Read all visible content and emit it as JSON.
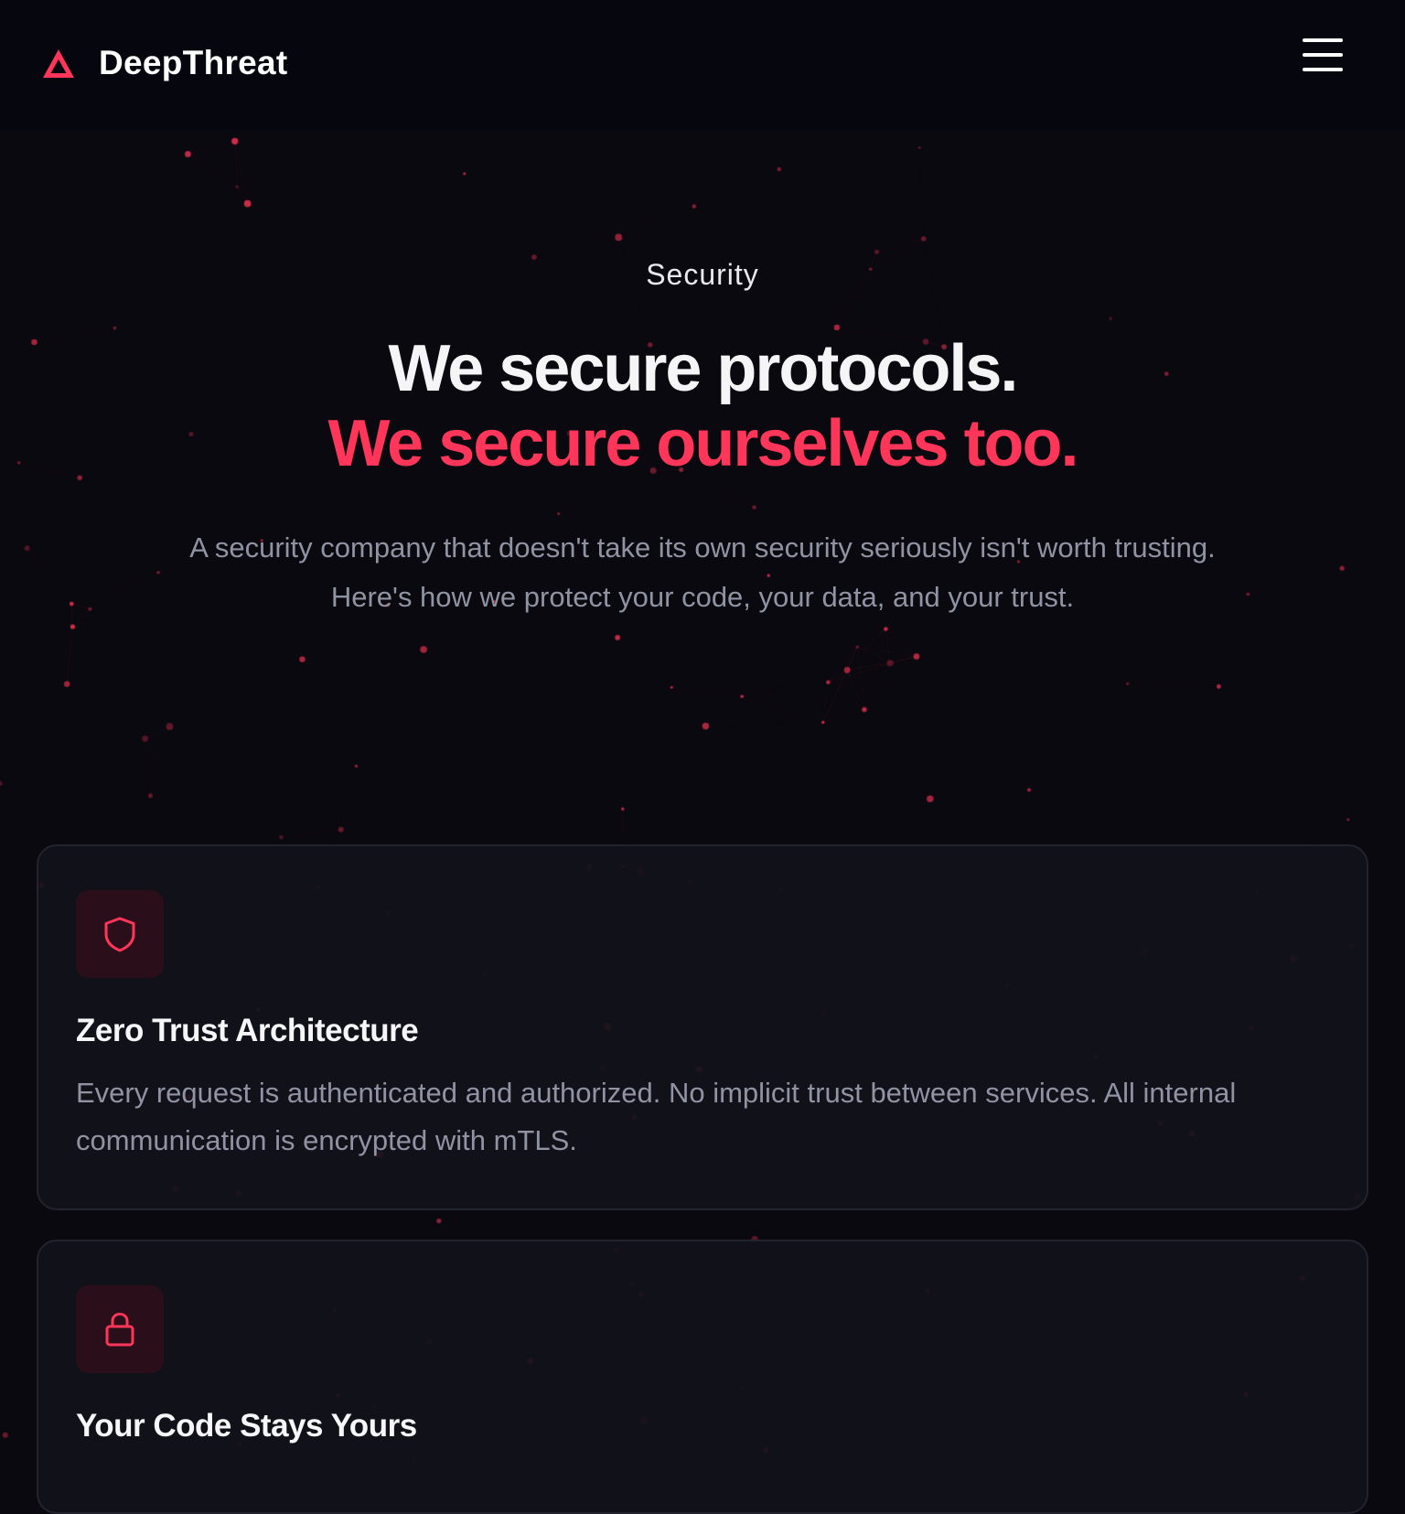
{
  "header": {
    "brand_name": "DeepThreat",
    "menu_icon": "hamburger-menu-icon",
    "logo_icon": "triangle-logo-icon"
  },
  "hero": {
    "eyebrow": "Security",
    "headline_line1": "We secure protocols.",
    "headline_line2": "We secure ourselves too.",
    "lead": "A security company that doesn't take its own security seriously isn't worth trusting. Here's how we protect your code, your data, and your trust."
  },
  "cards": [
    {
      "icon": "shield-icon",
      "title": "Zero Trust Architecture",
      "body": "Every request is authenticated and authorized. No implicit trust between services. All internal communication is encrypted with mTLS."
    },
    {
      "icon": "lock-icon",
      "title": "Your Code Stays Yours",
      "body": ""
    }
  ],
  "colors": {
    "background": "#09090f",
    "topbar": "#05060e",
    "accent": "#ff3559",
    "muted_text": "#8f93a3",
    "card_bg": "#12121a",
    "card_border": "#23232e",
    "icon_tile": "#2a0f1a"
  }
}
